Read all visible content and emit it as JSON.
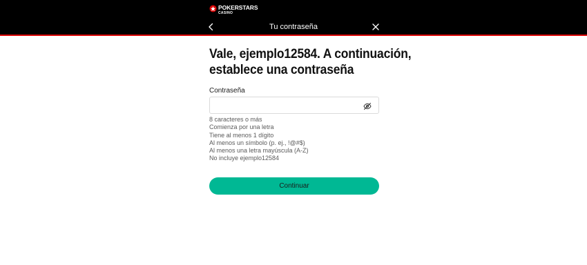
{
  "header": {
    "logo_main": "POKERSTARS",
    "logo_sub": "CASINO",
    "title": "Tu contraseña",
    "back_icon": "chevron-left-icon",
    "close_icon": "close-icon"
  },
  "main": {
    "heading_line1": "Vale, ejemplo12584. A continuación,",
    "heading_line2": "establece una contraseña",
    "password": {
      "label": "Contraseña",
      "value": "",
      "visibility_icon": "eye-off-icon"
    },
    "requirements": [
      "8 caracteres o más",
      "Comienza por una letra",
      "Tiene al menos 1 dígito",
      "Al menos un símbolo (p. ej., !@#$)",
      "Al menos una letra mayúscula (A-Z)",
      "No incluye ejemplo12584"
    ],
    "continue_label": "Continuar"
  },
  "colors": {
    "header_bg": "#000000",
    "header_accent": "#d90000",
    "button": "#00b894"
  }
}
